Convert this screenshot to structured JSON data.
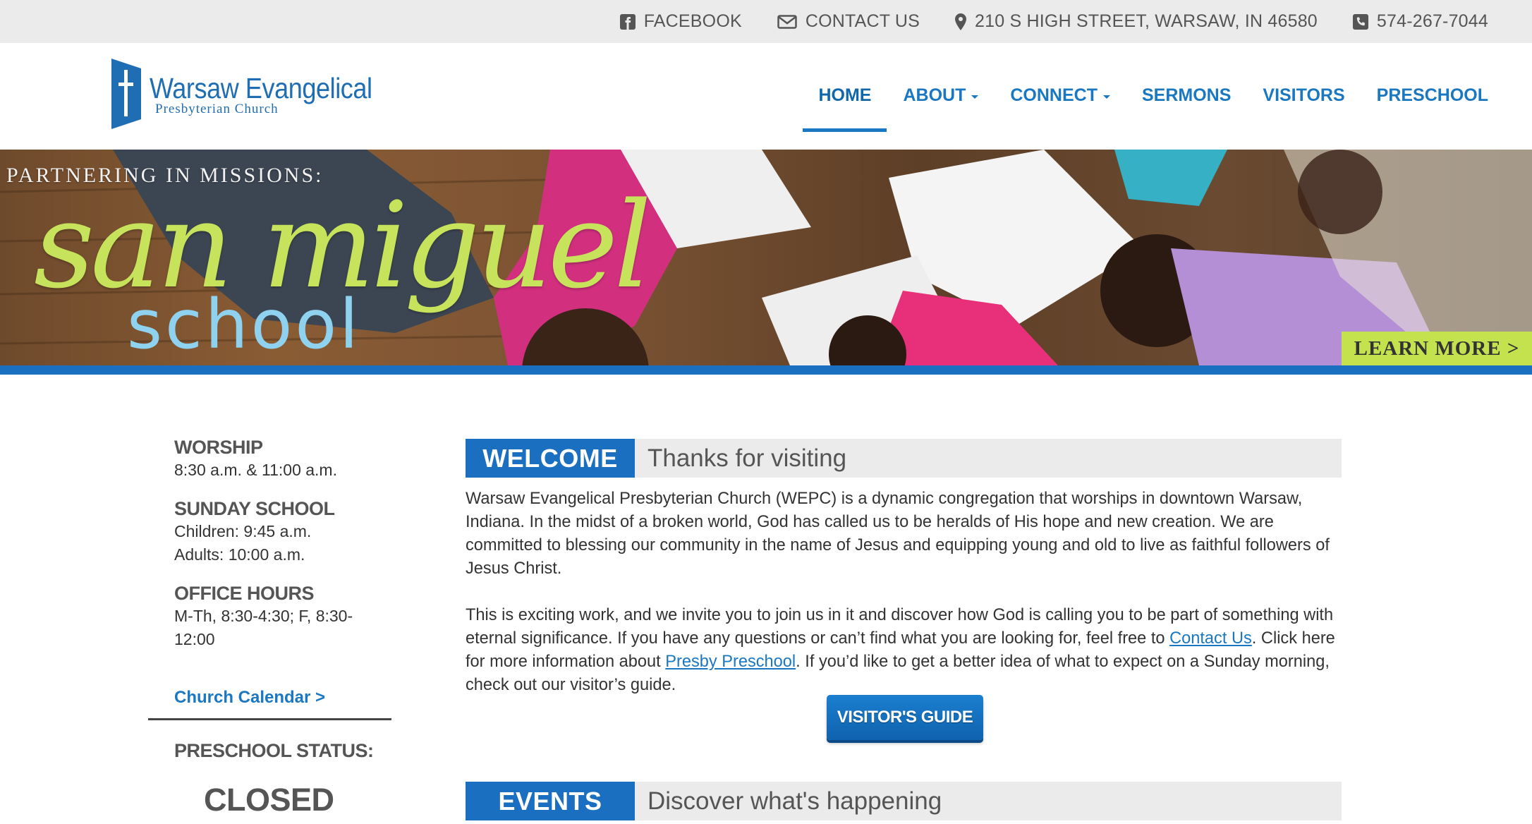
{
  "topbar": {
    "facebook": "FACEBOOK",
    "contact": "CONTACT US",
    "address": "210 S HIGH STREET, WARSAW, IN 46580",
    "phone": "574-267-7044",
    "icons": [
      "facebook-icon",
      "envelope-icon",
      "map-pin-icon",
      "phone-icon"
    ]
  },
  "logo": {
    "line1": "Warsaw Evangelical",
    "line2": "Presbyterian Church"
  },
  "nav": {
    "items": [
      {
        "label": "HOME",
        "active": true,
        "dropdown": false
      },
      {
        "label": "ABOUT",
        "active": false,
        "dropdown": true
      },
      {
        "label": "CONNECT",
        "active": false,
        "dropdown": true
      },
      {
        "label": "SERMONS",
        "active": false,
        "dropdown": false
      },
      {
        "label": "VISITORS",
        "active": false,
        "dropdown": false
      },
      {
        "label": "PRESCHOOL",
        "active": false,
        "dropdown": false
      }
    ]
  },
  "hero": {
    "kicker": "PARTNERING IN MISSIONS:",
    "script": "san miguel",
    "word": "school",
    "cta": "LEARN MORE >"
  },
  "sidebar": {
    "worship": {
      "head": "WORSHIP",
      "lines": [
        "8:30 a.m. & 11:00 a.m."
      ]
    },
    "sunday_school": {
      "head": "SUNDAY SCHOOL",
      "lines": [
        "Children: 9:45 a.m.",
        "Adults: 10:00 a.m."
      ]
    },
    "office_hours": {
      "head": "OFFICE HOURS",
      "lines": [
        "M-Th, 8:30-4:30; F, 8:30-",
        "12:00"
      ]
    },
    "calendar_link": "Church Calendar >",
    "preschool_status_label": "PRESCHOOL STATUS:",
    "preschool_status_value": "CLOSED"
  },
  "welcome": {
    "tag": "WELCOME",
    "sub": "Thanks for visiting",
    "p1": "Warsaw Evangelical Presbyterian Church (WEPC) is a dynamic congregation that worships in downtown Warsaw, Indiana. In the midst of a broken world, God has called us to be heralds of His hope and new creation. We are committed to blessing our community in the name of Jesus and equipping young and old to live as faithful followers of Jesus Christ.",
    "p2_a": "This is exciting work, and we invite you to join us in it and discover how God is calling you to be part of something with eternal significance. If you have any questions or can’t find what you are looking for, feel free to ",
    "p2_link1": "Contact Us",
    "p2_b": ". Click here for more information about ",
    "p2_link2": "Presby Preschool",
    "p2_c": ". If you’d like to get a better idea of what to expect on a Sunday morning, check out our visitor’s guide.",
    "button": "VISITOR'S GUIDE"
  },
  "events": {
    "tag": "EVENTS",
    "sub": "Discover what's happening"
  },
  "colors": {
    "primary_blue": "#1a6fc0",
    "link_blue": "#1a78c2",
    "accent_green": "#c4e24d",
    "topbar_gray": "#ebebeb"
  }
}
